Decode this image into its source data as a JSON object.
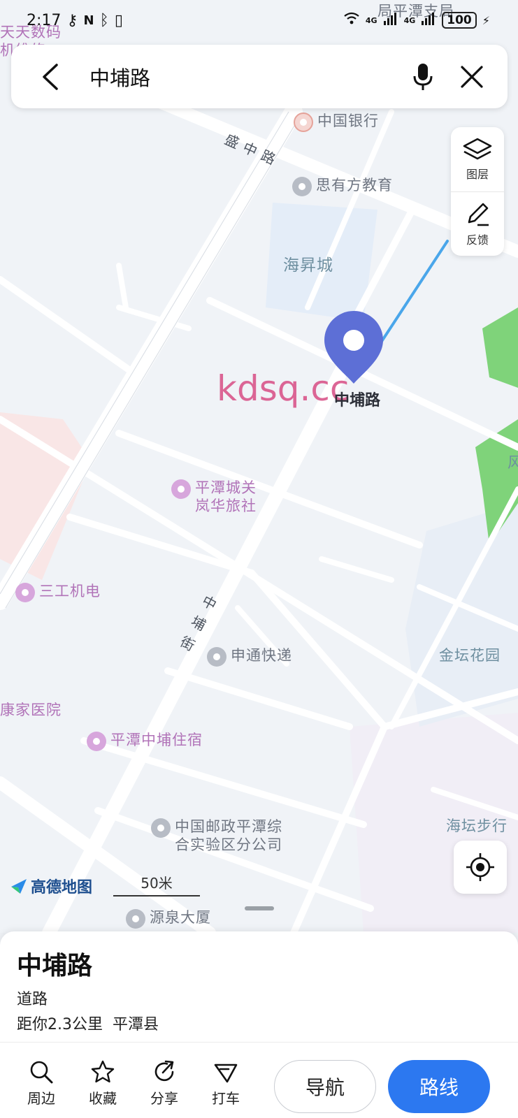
{
  "status": {
    "time": "2:17",
    "battery": "100",
    "net1": "4G",
    "net2": "4G"
  },
  "search": {
    "query": "中埔路"
  },
  "tools": {
    "layers": "图层",
    "feedback": "反馈"
  },
  "map": {
    "pin_label": "中埔路",
    "watermark": "kdsq.cc",
    "roads": {
      "shengzhong": "盛 中 路",
      "zhongpu_jie": [
        "中",
        "埔",
        "街"
      ]
    },
    "labels": {
      "top_left_1": "天天数码",
      "top_left_2": "机维修",
      "top_center": "局平潭支局",
      "bank": "中国银行",
      "edu": "思有方教育",
      "haisheng": "海昇城",
      "hotel1_l1": "平潭城关",
      "hotel1_l2": "岚华旅社",
      "sangong": "三工机电",
      "shentong": "申通快递",
      "jintan": "金坛花园",
      "hospital": "康家医院",
      "hotel2": "平潭中埔住宿",
      "post_l1": "中国邮政平潭综",
      "post_l2": "合实验区分公司",
      "haitan": "海坛步行",
      "yuanquan": "源泉大厦",
      "edge_right": "风"
    },
    "logo": "高德地图",
    "scale": "50米"
  },
  "sheet": {
    "title": "中埔路",
    "type": "道路",
    "distance": "距你2.3公里",
    "county": "平潭县",
    "actions": [
      "周边",
      "收藏",
      "分享",
      "打车"
    ],
    "nav": "导航",
    "route": "路线"
  },
  "colors": {
    "accent": "#2c78f0",
    "pin": "#5d6fd6",
    "park": "#7fd37a",
    "route_line": "#4aa6ea"
  }
}
